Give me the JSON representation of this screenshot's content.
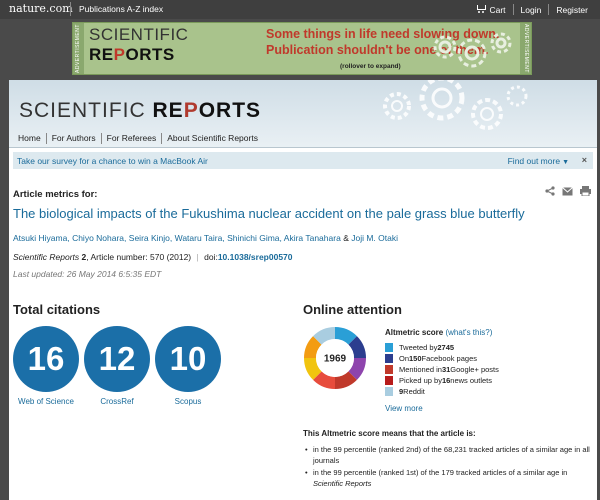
{
  "topbar": {
    "logo": "nature.com",
    "publications": "Publications A-Z index",
    "cart": "Cart",
    "login": "Login",
    "register": "Register"
  },
  "ad": {
    "side_text": "ADVERTISEMENT",
    "brand_light": "SCIENTIFIC",
    "brand_bold_1": "RE",
    "brand_gear": "P",
    "brand_bold_2": "ORTS",
    "line1": "Some things in life need slowing down.",
    "line2": "Publication shouldn't be one of them.",
    "rollover": "(rollover to expand)"
  },
  "masthead": {
    "title_light": "SCIENTIFIC",
    "title_bold_1": "RE",
    "title_gear": "P",
    "title_bold_2": "ORTS"
  },
  "nav": [
    "Home",
    "For Authors",
    "For Referees",
    "About Scientific Reports"
  ],
  "survey": {
    "text": "Take our survey for a chance to win a MacBook Air",
    "find_more": "Find out more",
    "close": "×"
  },
  "article": {
    "metrics_for": "Article metrics for:",
    "title": "The biological impacts of the Fukushima nuclear accident on the pale grass blue butterfly",
    "authors": [
      "Atsuki Hiyama",
      "Chiyo Nohara",
      "Seira Kinjo",
      "Wataru Taira",
      "Shinichi Gima",
      "Akira Tanahara"
    ],
    "last_author": "Joji M. Otaki",
    "journal": "Scientific Reports",
    "volume": "2",
    "article_number_label": ", Article number: 570 (2012)",
    "doi_label": "doi:",
    "doi": "10.1038/srep00570",
    "last_updated": "Last updated: 26 May 2014 6:5:35 EDT"
  },
  "citations": {
    "title": "Total citations",
    "items": [
      {
        "value": "16",
        "label": "Web of Science"
      },
      {
        "value": "12",
        "label": "CrossRef"
      },
      {
        "value": "10",
        "label": "Scopus"
      }
    ]
  },
  "attention": {
    "title": "Online attention",
    "score": "1969",
    "score_label": "Altmetric score",
    "whats_this": "(what's this?)",
    "sources": [
      {
        "pre": "Tweeted by ",
        "count": "2745",
        "post": "",
        "color": "#2a9fd6"
      },
      {
        "pre": "On ",
        "count": "150",
        "post": " Facebook pages",
        "color": "#2c3e8f"
      },
      {
        "pre": "Mentioned in ",
        "count": "31",
        "post": " Google+ posts",
        "color": "#c0392b"
      },
      {
        "pre": "Picked up by ",
        "count": "16",
        "post": " news outlets",
        "color": "#b71c1c"
      },
      {
        "pre": "",
        "count": "9",
        "post": " Reddit",
        "color": "#a9cde0"
      }
    ],
    "view_more": "View more",
    "means_title": "This Altmetric score means that the article is:",
    "percentiles": [
      "in the 99 percentile (ranked 2nd) of the 68,231 tracked articles of a similar age in all journals",
      "in the 99 percentile (ranked 1st) of the 179 tracked articles of a similar age in"
    ],
    "percentile_journal": "Scientific Reports"
  },
  "colors": {
    "accent_blue": "#1b6fa8",
    "link_blue": "#1a6b9a",
    "donut": [
      "#2a9fd6",
      "#2c3e8f",
      "#8e44ad",
      "#c0392b",
      "#e74c3c",
      "#f1c40f",
      "#f39c12",
      "#a9cde0"
    ]
  }
}
